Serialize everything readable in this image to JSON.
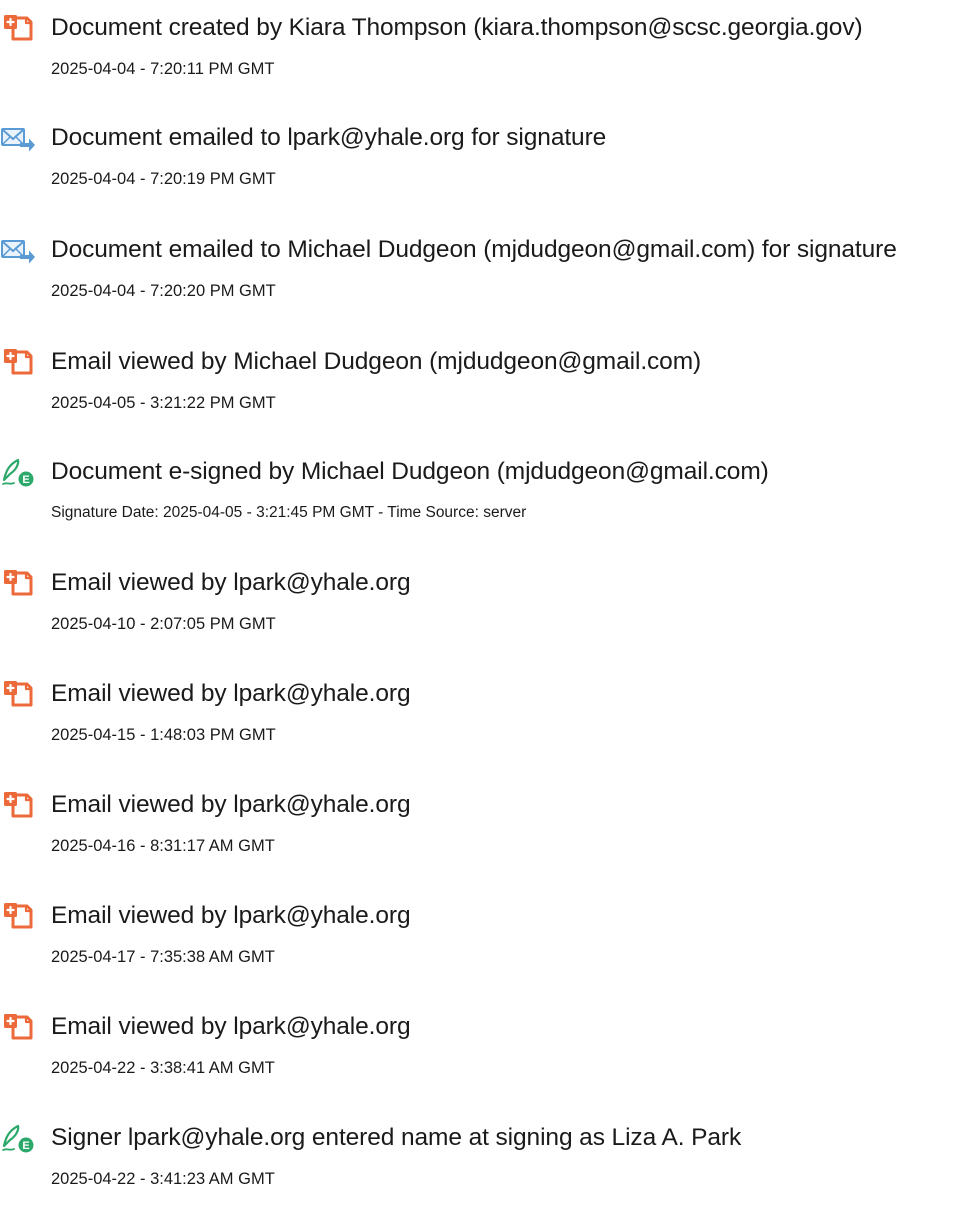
{
  "colors": {
    "doc_icon": "#ec6a3a",
    "mail_icon": "#5b9bd5",
    "sign_icon": "#2ba86a",
    "text": "#1a1a1a"
  },
  "events": [
    {
      "icon": "document-icon",
      "title": "Document created by Kiara Thompson (kiara.thompson@scsc.georgia.gov)",
      "sub": "2025-04-04 - 7:20:11 PM GMT"
    },
    {
      "icon": "email-icon",
      "title": "Document emailed to lpark@yhale.org for signature",
      "sub": "2025-04-04 - 7:20:19 PM GMT"
    },
    {
      "icon": "email-icon",
      "title": "Document emailed to Michael Dudgeon (mjdudgeon@gmail.com) for signature",
      "sub": "2025-04-04 - 7:20:20 PM GMT"
    },
    {
      "icon": "document-icon",
      "title": "Email viewed by Michael Dudgeon (mjdudgeon@gmail.com)",
      "sub": "2025-04-05 - 3:21:22 PM GMT"
    },
    {
      "icon": "esign-icon",
      "title": "Document e-signed by Michael Dudgeon (mjdudgeon@gmail.com)",
      "sub": "Signature Date: 2025-04-05 - 3:21:45 PM GMT - Time Source: server"
    },
    {
      "icon": "document-icon",
      "title": "Email viewed by lpark@yhale.org",
      "sub": "2025-04-10 - 2:07:05 PM GMT"
    },
    {
      "icon": "document-icon",
      "title": "Email viewed by lpark@yhale.org",
      "sub": "2025-04-15 - 1:48:03 PM GMT"
    },
    {
      "icon": "document-icon",
      "title": "Email viewed by lpark@yhale.org",
      "sub": "2025-04-16 - 8:31:17 AM GMT"
    },
    {
      "icon": "document-icon",
      "title": "Email viewed by lpark@yhale.org",
      "sub": "2025-04-17 - 7:35:38 AM GMT"
    },
    {
      "icon": "document-icon",
      "title": "Email viewed by lpark@yhale.org",
      "sub": "2025-04-22 - 3:38:41 AM GMT"
    },
    {
      "icon": "esign-icon",
      "title": "Signer lpark@yhale.org entered name at signing as Liza A. Park",
      "sub": "2025-04-22 - 3:41:23 AM GMT"
    }
  ]
}
